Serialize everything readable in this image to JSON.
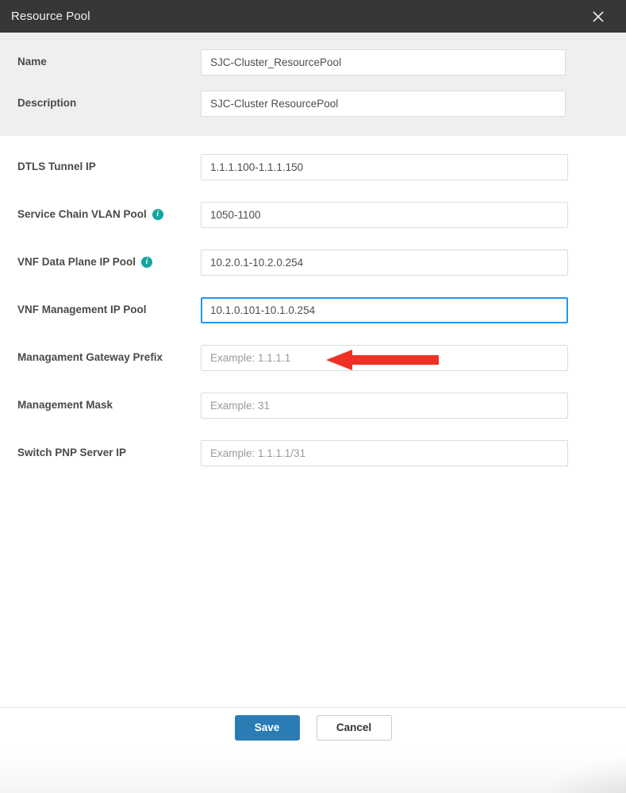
{
  "dialog": {
    "title": "Resource Pool",
    "close_icon": "close-icon",
    "titlebar_color": "#373737"
  },
  "sections": {
    "identity": {
      "background_color": "#efefef",
      "fields": [
        {
          "label": "Name",
          "value": "SJC-Cluster_ResourcePool",
          "placeholder": "",
          "info": false,
          "focused": false
        },
        {
          "label": "Description",
          "value": "SJC-Cluster ResourcePool",
          "placeholder": "",
          "info": false,
          "focused": false
        }
      ]
    },
    "pools": {
      "background_color": "#ffffff",
      "fields": [
        {
          "label": "DTLS Tunnel IP",
          "value": "1.1.1.100-1.1.1.150",
          "placeholder": "",
          "info": false,
          "focused": false
        },
        {
          "label": "Service Chain VLAN Pool",
          "value": "1050-1100",
          "placeholder": "",
          "info": true,
          "focused": false
        },
        {
          "label": "VNF Data Plane IP Pool",
          "value": "10.2.0.1-10.2.0.254",
          "placeholder": "",
          "info": true,
          "focused": false
        },
        {
          "label": "VNF Management IP Pool",
          "value": "10.1.0.101-10.1.0.254",
          "placeholder": "",
          "info": false,
          "focused": true
        },
        {
          "label": "Managament Gateway Prefix",
          "value": "",
          "placeholder": "Example: 1.1.1.1",
          "info": false,
          "focused": false
        },
        {
          "label": "Management Mask",
          "value": "",
          "placeholder": "Example: 31",
          "info": false,
          "focused": false
        },
        {
          "label": "Switch PNP Server IP",
          "value": "",
          "placeholder": "Example: 1.1.1.1/31",
          "info": false,
          "focused": false
        }
      ]
    }
  },
  "footer": {
    "save_label": "Save",
    "cancel_label": "Cancel",
    "save_color": "#2b7cb5"
  },
  "annotation": {
    "type": "arrow-left",
    "color": "#ee3124",
    "points_at": "VNF Management IP Pool"
  },
  "info_icon": {
    "glyph": "i",
    "color": "#12a5a0"
  }
}
